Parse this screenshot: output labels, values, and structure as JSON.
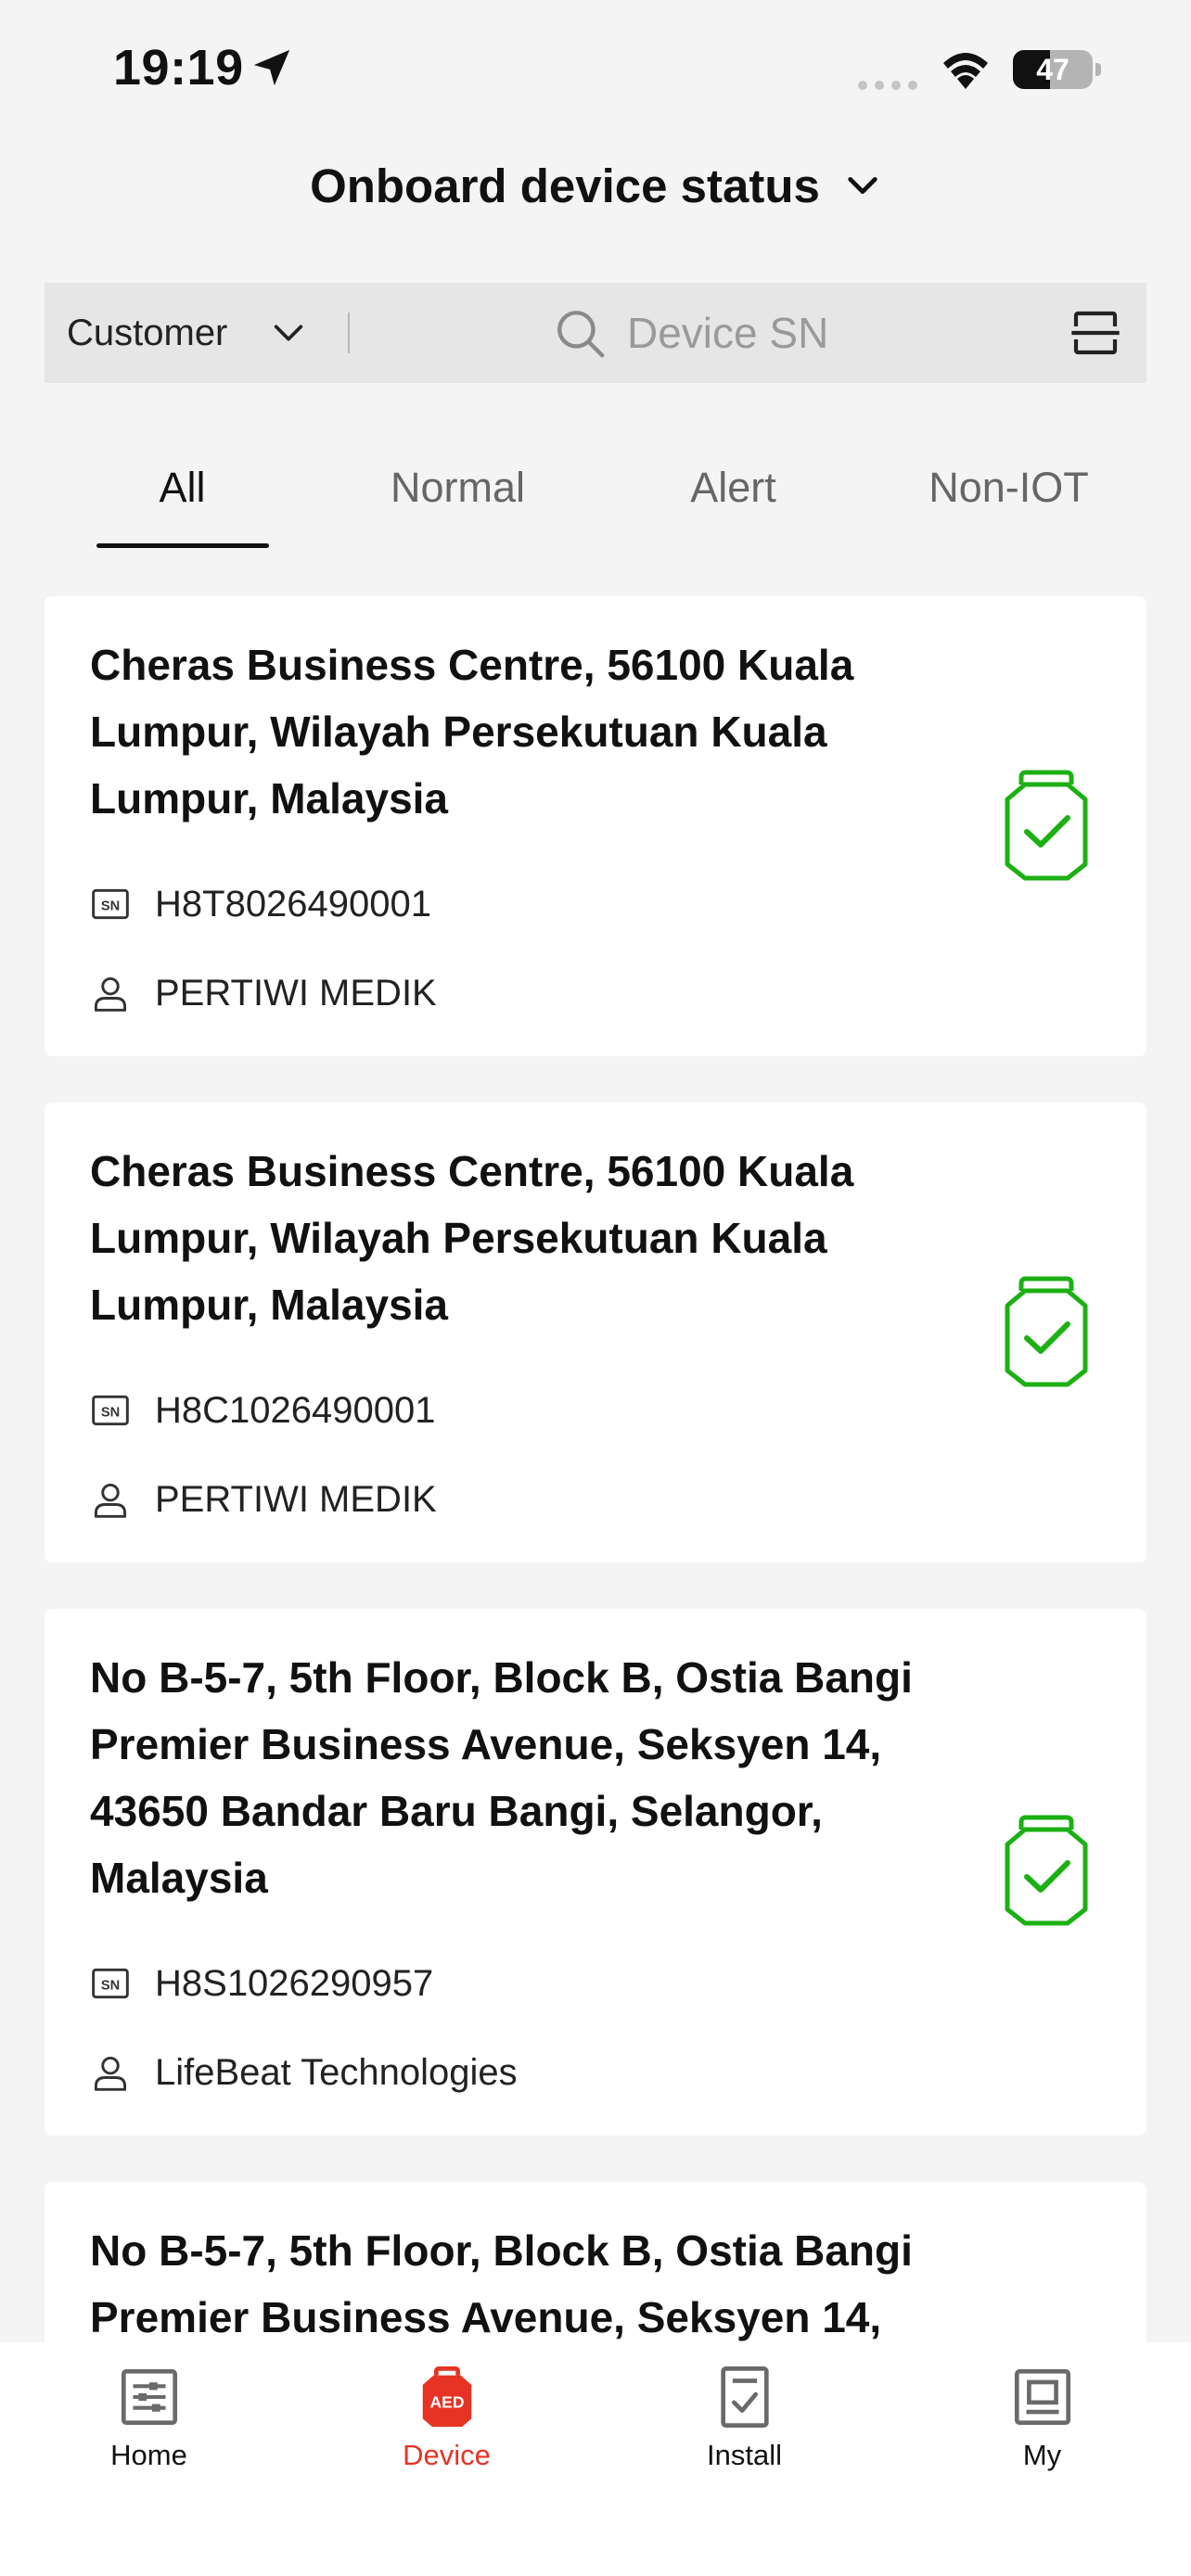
{
  "status_bar": {
    "time": "19:19",
    "battery_level": "47",
    "battery_fraction": 0.47
  },
  "header": {
    "title": "Onboard device status",
    "title_icon": "chevron-down-icon"
  },
  "search_bar": {
    "filter_label": "Customer",
    "search_placeholder": "Device SN",
    "icons": [
      "chevron-down-icon",
      "search-icon",
      "scan-icon"
    ]
  },
  "tabs": [
    {
      "label": "All",
      "active": true
    },
    {
      "label": "Normal",
      "active": false
    },
    {
      "label": "Alert",
      "active": false
    },
    {
      "label": "Non-IOT",
      "active": false
    }
  ],
  "devices": [
    {
      "address": "Cheras Business Centre, 56100 Kuala Lumpur, Wilayah Persekutuan Kuala Lumpur, Malaysia",
      "serial": "H8T8026490001",
      "customer": "PERTIWI MEDIK",
      "status_icon": "device-ok-icon"
    },
    {
      "address": "Cheras Business Centre, 56100 Kuala Lumpur, Wilayah Persekutuan Kuala Lumpur, Malaysia",
      "serial": "H8C1026490001",
      "customer": "PERTIWI MEDIK",
      "status_icon": "device-ok-icon"
    },
    {
      "address": "No B-5-7, 5th Floor, Block B, Ostia Bangi Premier Business Avenue, Seksyen 14, 43650 Bandar Baru Bangi, Selangor, Malaysia",
      "serial": "H8S1026290957",
      "customer": "LifeBeat Technologies",
      "status_icon": "device-ok-icon"
    },
    {
      "address": "No B-5-7, 5th Floor, Block B, Ostia Bangi Premier Business Avenue, Seksyen 14,",
      "serial": "",
      "customer": "",
      "status_icon": "device-ok-icon"
    }
  ],
  "bottom_nav": [
    {
      "label": "Home",
      "icon": "home-icon",
      "active": false
    },
    {
      "label": "Device",
      "icon": "aed-device-icon",
      "icon_text": "AED",
      "active": true
    },
    {
      "label": "Install",
      "icon": "install-checklist-icon",
      "active": false
    },
    {
      "label": "My",
      "icon": "profile-icon",
      "active": false
    }
  ],
  "colors": {
    "accent": "#e63323",
    "status_ok": "#1cb014",
    "background": "#f4f4f4"
  }
}
